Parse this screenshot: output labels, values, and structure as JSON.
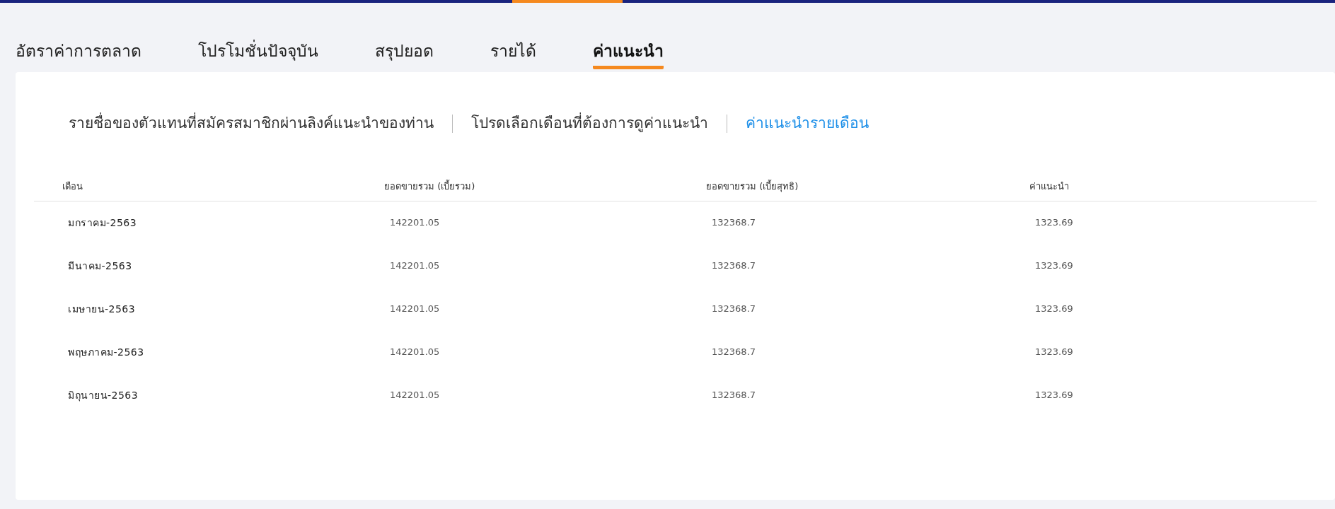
{
  "tabs": [
    {
      "label": "อัตราค่าการตลาด",
      "selected": false
    },
    {
      "label": "โปรโมชั่นปัจจุบัน",
      "selected": false
    },
    {
      "label": "สรุปยอด",
      "selected": false
    },
    {
      "label": "รายได้",
      "selected": false
    },
    {
      "label": "ค่าแนะนำ",
      "selected": true
    }
  ],
  "sub_links": [
    {
      "label": "รายชื่อของตัวแทนที่สมัครสมาชิกผ่านลิงค์แนะนำของท่าน",
      "selected": false
    },
    {
      "label": "โปรดเลือกเดือนที่ต้องการดูค่าแนะนำ",
      "selected": false
    },
    {
      "label": "ค่าแนะนำรายเดือน",
      "selected": true
    }
  ],
  "table": {
    "columns": [
      "เดือน",
      "ยอดขายรวม (เบี้ยรวม)",
      "ยอดขายรวม (เบี้ยสุทธิ)",
      "ค่าแนะนำ"
    ],
    "rows": [
      [
        "มกราคม-2563",
        "142201.05",
        "132368.7",
        "1323.69"
      ],
      [
        "มีนาคม-2563",
        "142201.05",
        "132368.7",
        "1323.69"
      ],
      [
        "เมษายน-2563",
        "142201.05",
        "132368.7",
        "1323.69"
      ],
      [
        "พฤษภาคม-2563",
        "142201.05",
        "132368.7",
        "1323.69"
      ],
      [
        "มิถุนายน-2563",
        "142201.05",
        "132368.7",
        "1323.69"
      ]
    ]
  }
}
